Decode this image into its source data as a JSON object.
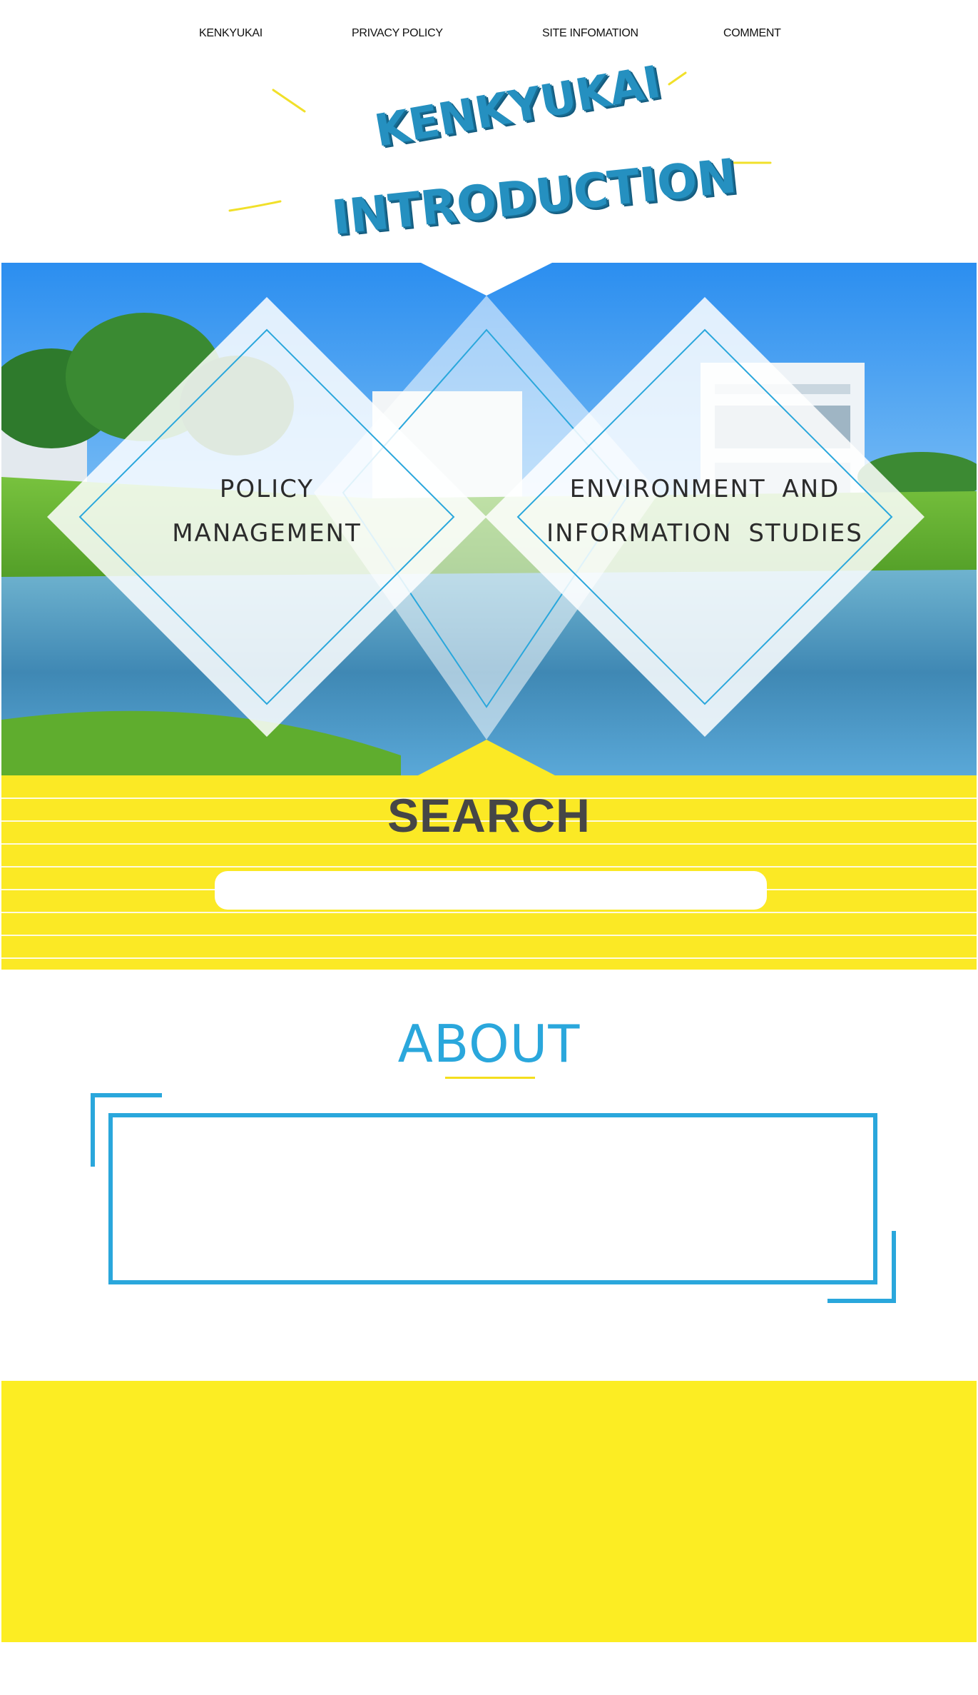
{
  "nav": {
    "items": [
      {
        "label": "KENKYUKAI"
      },
      {
        "label": "PRIVACY POLICY"
      },
      {
        "label": "SITE INFOMATION"
      },
      {
        "label": "COMMENT"
      }
    ]
  },
  "header": {
    "title_line1": "KENKYUKAI",
    "title_line2": "INTRODUCTION"
  },
  "hero": {
    "left": {
      "line1": "POLICY",
      "line2": "MANAGEMENT"
    },
    "right": {
      "line1": "ENVIRONMENT AND",
      "line2": "INFORMATION STUDIES"
    }
  },
  "search": {
    "title": "SEARCH",
    "placeholder": ""
  },
  "about": {
    "title": "ABOUT",
    "body": ""
  },
  "colors": {
    "accent_blue": "#2aa7dc",
    "title_blue": "#1f86b0",
    "accent_yellow": "#fbe925",
    "search_title": "#464646"
  }
}
